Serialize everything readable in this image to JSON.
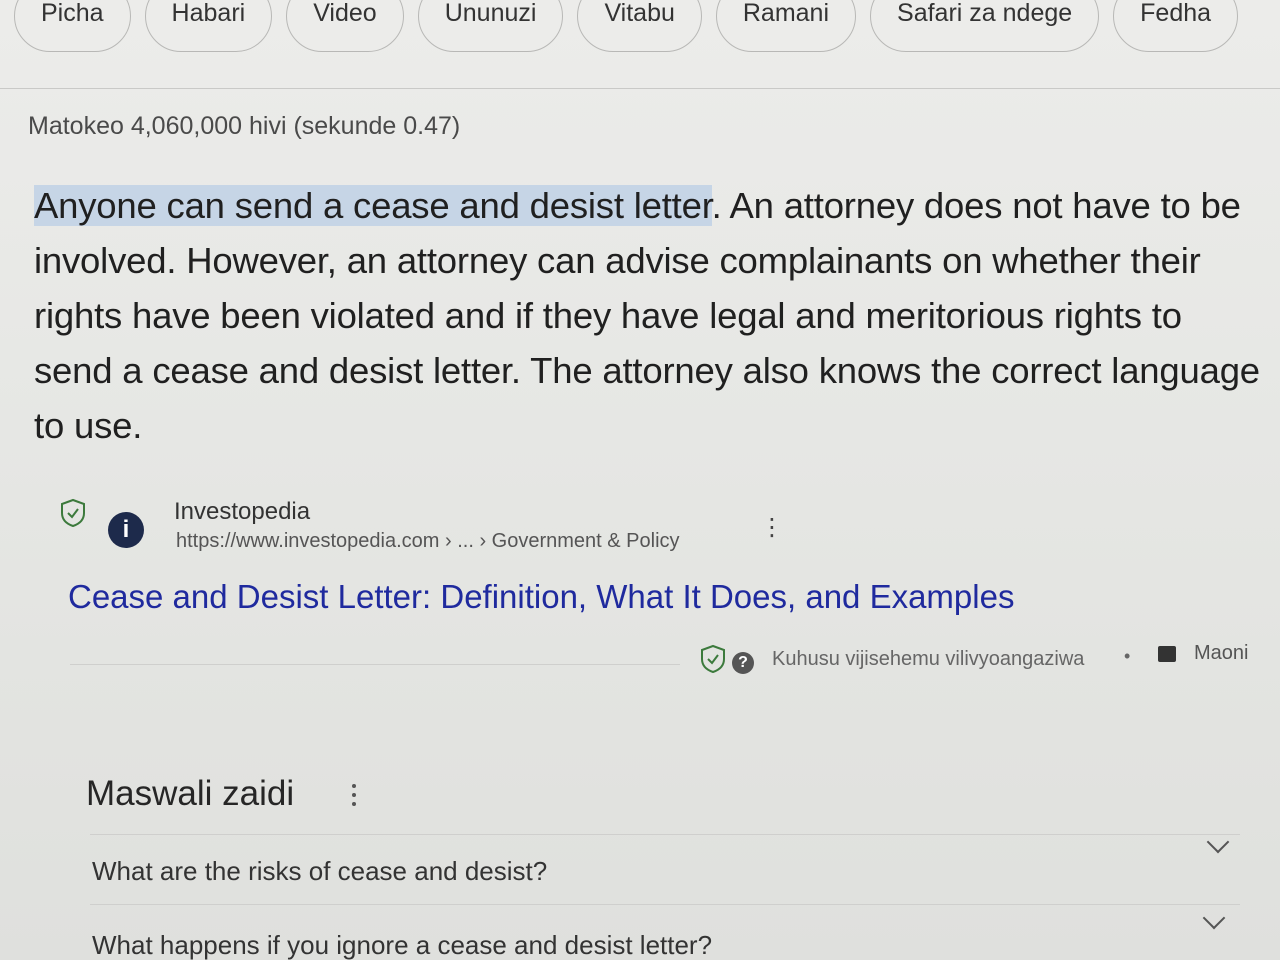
{
  "tabs": [
    "Picha",
    "Habari",
    "Video",
    "Ununuzi",
    "Vitabu",
    "Ramani",
    "Safari za ndege",
    "Fedha"
  ],
  "results_stats": "Matokeo 4,060,000 hivi (sekunde 0.47)",
  "featured_snippet": {
    "highlighted": "Anyone can send a cease and desist letter",
    "rest": ". An attorney does not have to be involved. However, an attorney can advise complainants on whether their rights have been violated and if they have legal and meritorious rights to send a cease and desist letter. The attorney also knows the correct language to use."
  },
  "source": {
    "name": "Investopedia",
    "url": "https://www.investopedia.com › ... › Government & Policy",
    "logo_letter": "i"
  },
  "result_title": "Cease and Desist Letter: Definition, What It Does, and Examples",
  "featured_footer": {
    "about_label": "Kuhusu vijisehemu vilivyoangaziwa",
    "separator": "•",
    "feedback_label": "Maoni"
  },
  "people_also_ask": {
    "title": "Maswali zaidi",
    "questions": [
      "What are the risks of cease and desist?",
      "What happens if you ignore a cease and desist letter?"
    ]
  },
  "colors": {
    "link": "#1f2a9e",
    "highlight": "#c6d5e6",
    "background": "#e9e9e7"
  }
}
